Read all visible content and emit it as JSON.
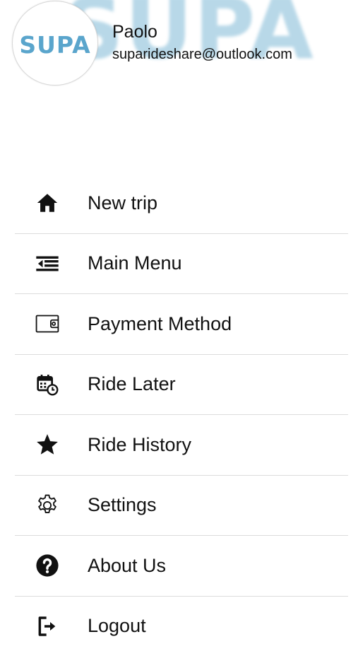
{
  "user": {
    "name": "Paolo",
    "email": "suparideshare@outlook.com"
  },
  "brand": {
    "logo_text": "SUPA",
    "background_text": "SUPA",
    "accent_color": "#5aa5cc"
  },
  "menu": {
    "items": [
      {
        "label": "New trip",
        "icon": "home-icon"
      },
      {
        "label": "Main Menu",
        "icon": "menu-open-icon"
      },
      {
        "label": "Payment Method",
        "icon": "wallet-icon"
      },
      {
        "label": "Ride Later",
        "icon": "calendar-clock-icon"
      },
      {
        "label": "Ride History",
        "icon": "star-icon"
      },
      {
        "label": "Settings",
        "icon": "gear-icon"
      },
      {
        "label": "About Us",
        "icon": "help-circle-icon"
      },
      {
        "label": "Logout",
        "icon": "logout-icon"
      }
    ]
  }
}
